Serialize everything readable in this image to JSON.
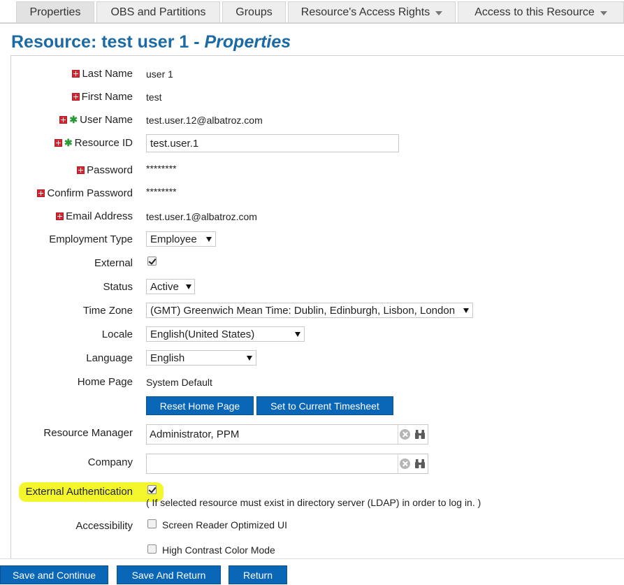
{
  "tabs": [
    {
      "label": "Properties"
    },
    {
      "label": "OBS and Partitions"
    },
    {
      "label": "Groups"
    },
    {
      "label": "Resource's Access Rights"
    },
    {
      "label": "Access to this Resource"
    }
  ],
  "page": {
    "title_prefix": "Resource: test user 1 - ",
    "title_section": "Properties"
  },
  "fields": {
    "last_name": {
      "label": "Last Name",
      "value": "user 1"
    },
    "first_name": {
      "label": "First Name",
      "value": "test"
    },
    "user_name": {
      "label": "User Name",
      "value": "test.user.12@albatroz.com"
    },
    "resource_id": {
      "label": "Resource ID",
      "value": "test.user.1"
    },
    "password": {
      "label": "Password",
      "value": "********"
    },
    "confirm_password": {
      "label": "Confirm Password",
      "value": "********"
    },
    "email": {
      "label": "Email Address",
      "value": "test.user.1@albatroz.com"
    },
    "employment_type": {
      "label": "Employment Type",
      "value": "Employee"
    },
    "external": {
      "label": "External",
      "checked": true
    },
    "status": {
      "label": "Status",
      "value": "Active"
    },
    "time_zone": {
      "label": "Time Zone",
      "value": "(GMT) Greenwich Mean Time: Dublin, Edinburgh, Lisbon, London"
    },
    "locale": {
      "label": "Locale",
      "value": "English(United States)"
    },
    "language": {
      "label": "Language",
      "value": "English"
    },
    "home_page": {
      "label": "Home Page",
      "value": "System Default"
    },
    "resource_manager": {
      "label": "Resource Manager",
      "value": "Administrator, PPM"
    },
    "company": {
      "label": "Company",
      "value": ""
    },
    "external_auth": {
      "label": "External Authentication",
      "checked": true,
      "note": "( If selected resource must exist in directory server (LDAP) in order to log in. )"
    },
    "accessibility": {
      "label": "Accessibility",
      "options": [
        {
          "label": "Screen Reader Optimized UI",
          "checked": false
        },
        {
          "label": "High Contrast Color Mode",
          "checked": false
        }
      ]
    }
  },
  "buttons": {
    "reset_home_page": "Reset Home Page",
    "set_current_timesheet": "Set to Current Timesheet",
    "save_continue": "Save and Continue",
    "save_return": "Save And Return",
    "return": "Return"
  },
  "colors": {
    "title": "#1b6aa5",
    "button": "#0a66b7",
    "required": "#d9232e",
    "key": "#2a9a3a",
    "highlight": "#f3f62a"
  }
}
